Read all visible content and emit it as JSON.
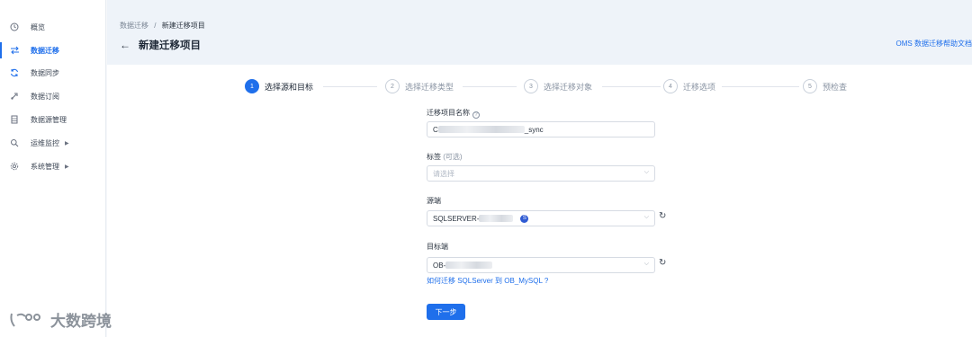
{
  "sidebar": {
    "items": [
      {
        "label": "概览",
        "icon": "clock-icon"
      },
      {
        "label": "数据迁移",
        "icon": "swap-icon",
        "active": true
      },
      {
        "label": "数据同步",
        "icon": "sync-icon"
      },
      {
        "label": "数据订阅",
        "icon": "subscribe-icon"
      },
      {
        "label": "数据源管理",
        "icon": "database-icon"
      },
      {
        "label": "运维监控",
        "icon": "monitor-icon",
        "expandable": true
      },
      {
        "label": "系统管理",
        "icon": "gear-icon",
        "expandable": true
      }
    ]
  },
  "header": {
    "breadcrumb_parent": "数据迁移",
    "breadcrumb_sep": "/",
    "breadcrumb_current": "新建迁移项目",
    "title": "新建迁移项目",
    "help_link": "OMS 数据迁移帮助文档"
  },
  "steps": [
    {
      "num": "1",
      "label": "选择源和目标",
      "active": true
    },
    {
      "num": "2",
      "label": "选择迁移类型"
    },
    {
      "num": "3",
      "label": "选择迁移对象"
    },
    {
      "num": "4",
      "label": "迁移选项"
    },
    {
      "num": "5",
      "label": "预检查"
    }
  ],
  "form": {
    "name_label": "迁移项目名称",
    "name_value_prefix": "C",
    "name_value_suffix": "_sync",
    "tag_label": "标签",
    "tag_optional": "(可选)",
    "tag_placeholder": "请选择",
    "source_label": "源端",
    "source_value": "SQLSERVER-",
    "source_badge": "S",
    "target_label": "目标端",
    "target_value": "OB-",
    "help_link": "如何迁移 SQLServer 到 OB_MySQL ?",
    "next_button": "下一步"
  },
  "watermark": "大数跨境",
  "colors": {
    "accent": "#1f6feb",
    "header_bg": "#eef3f9"
  }
}
